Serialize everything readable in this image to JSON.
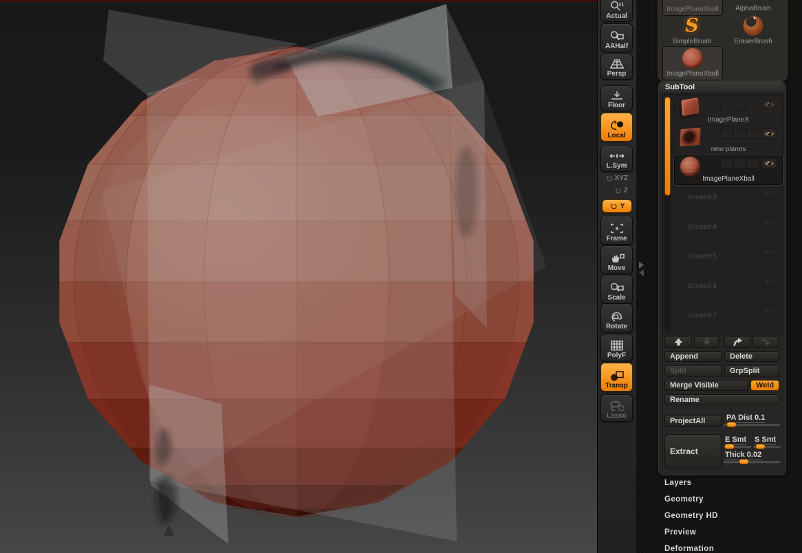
{
  "window": {
    "top_strip_color": "#3f0e07"
  },
  "canvas": {
    "bg_top": "#181818",
    "bg_bottom": "#464646",
    "sphere_bands": [
      "#8c4135",
      "#93493c",
      "#985747",
      "#9c6253",
      "#9d6757",
      "#985b4b",
      "#8f4a39",
      "#85382a",
      "#77291b",
      "#601b0f",
      "#471007",
      "#340903"
    ],
    "meridian_color": "rgba(115,38,26,0.45)",
    "ring_color": "rgba(50,12,6,0.22)",
    "plane_color": "#c6c9cb",
    "sketch_color": "#1d2226"
  },
  "toolbar": {
    "items": [
      {
        "label": "Actual",
        "icon": "zoom-actual",
        "name": "actual"
      },
      {
        "label": "AAHalf",
        "icon": "zoom-half",
        "name": "aahalf"
      },
      {
        "label": "Persp",
        "icon": "persp",
        "name": "persp"
      },
      {
        "label": "Floor",
        "icon": "floor",
        "name": "floor"
      },
      {
        "label": "Local",
        "icon": "local",
        "name": "local",
        "active": true
      },
      {
        "label": "L.Sym",
        "icon": "lsym",
        "name": "lsym"
      },
      {
        "label": "XYZ",
        "icon": "rot",
        "name": "rot-xyz",
        "bare": true,
        "dim": true
      },
      {
        "label": "Z",
        "icon": "rot",
        "name": "rot-z",
        "bare": true,
        "dim": true
      },
      {
        "label": "Y",
        "icon": "rot",
        "name": "rot-y",
        "mini": true,
        "active": true
      },
      {
        "label": "Frame",
        "icon": "frame",
        "name": "frame"
      },
      {
        "label": "Move",
        "icon": "move",
        "name": "move"
      },
      {
        "label": "Scale",
        "icon": "scale",
        "name": "scale"
      },
      {
        "label": "Rotate",
        "icon": "rotate",
        "name": "rotate"
      },
      {
        "label": "PolyF",
        "icon": "polyf",
        "name": "polyf"
      },
      {
        "label": "Transp",
        "icon": "transp",
        "name": "transp",
        "active": true
      },
      {
        "label": "Lasso",
        "icon": "lasso",
        "name": "lasso",
        "dim": true
      }
    ]
  },
  "brush_palette": {
    "tiles": [
      {
        "label": "ImagePlaneXball",
        "thumb": "cut-orange",
        "selected": true,
        "dimlabel": true
      },
      {
        "label": "AlphaBrush",
        "thumb": "cut-blue"
      },
      {
        "label": "SimpleBrush",
        "thumb": "orange-s"
      },
      {
        "label": "EraserBrush",
        "thumb": "eraser"
      },
      {
        "label": "ImagePlaneXball",
        "thumb": "red-ball",
        "selected": true
      }
    ]
  },
  "subtool": {
    "title": "SubTool",
    "items": [
      {
        "label": "ImagePlaneX",
        "thumb": "cube",
        "eye_dim": true
      },
      {
        "label": "new planes",
        "thumb": "plane"
      },
      {
        "label": "ImagePlaneXball",
        "thumb": "ball",
        "selected": true
      },
      {
        "label": "Unused 3",
        "unused": true
      },
      {
        "label": "Unused 4",
        "unused": true
      },
      {
        "label": "Unused 5",
        "unused": true
      },
      {
        "label": "Unused 6",
        "unused": true
      },
      {
        "label": "Unused 7",
        "unused": true
      }
    ],
    "arrows": [
      {
        "icon": "arrow-up",
        "name": "move-up",
        "bright": true
      },
      {
        "icon": "arrow-down",
        "name": "move-down",
        "bright": false
      },
      {
        "icon": "curve-right",
        "name": "duplicate",
        "bright": true
      },
      {
        "icon": "curve-down",
        "name": "insert",
        "bright": false
      }
    ],
    "actions": {
      "append": "Append",
      "delete": "Delete",
      "split": "Split",
      "grpsplit": "GrpSplit",
      "merge": "Merge Visible",
      "weld": "Weld",
      "rename": "Rename",
      "projectall": "ProjectAll",
      "extract": "Extract"
    },
    "sliders": {
      "pa_dist": {
        "label": "PA Dist",
        "value": "0.1",
        "pos": 0.06
      },
      "e_smt": {
        "label": "E Smt",
        "pos": 0.02
      },
      "s_smt": {
        "label": "S Smt",
        "pos": 0.12
      },
      "thick": {
        "label": "Thick",
        "value": "0.02",
        "pos": 0.33
      }
    }
  },
  "sections": [
    "Layers",
    "Geometry",
    "Geometry HD",
    "Preview",
    "Deformation"
  ],
  "colors": {
    "accent": "#f5820f"
  }
}
